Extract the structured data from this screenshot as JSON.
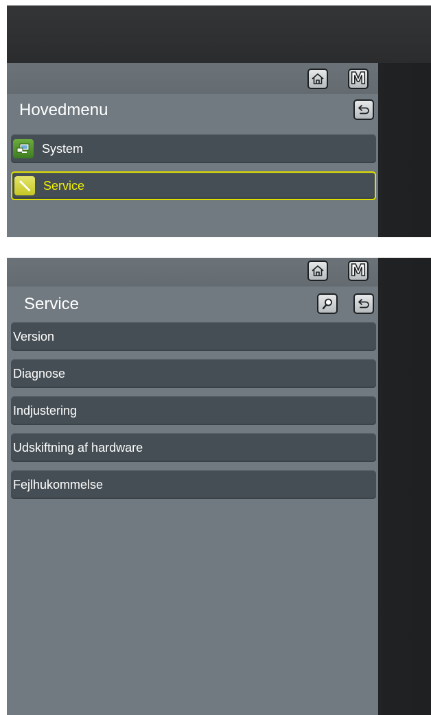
{
  "colors": {
    "screen_bg": "#707a80",
    "item_bg": "#454e54",
    "selected_border": "#dede00",
    "selected_text": "#f2f200",
    "bezel": "#232527"
  },
  "top_screen": {
    "title": "Hovedmenu",
    "header_icons": [
      "home-icon",
      "m-icon"
    ],
    "back_icon": "back-icon",
    "m_label": "M",
    "items": [
      {
        "label": "System",
        "icon": "system-icon",
        "selected": false
      },
      {
        "label": "Service",
        "icon": "wrench-icon",
        "selected": true
      }
    ]
  },
  "bottom_screen": {
    "title": "Service",
    "header_icons": [
      "home-icon",
      "m-icon"
    ],
    "search_icon": "search-icon",
    "back_icon": "back-icon",
    "m_label": "M",
    "items": [
      {
        "label": "Version"
      },
      {
        "label": "Diagnose"
      },
      {
        "label": "Indjustering"
      },
      {
        "label": "Udskiftning af hardware"
      },
      {
        "label": "Fejlhukommelse"
      }
    ]
  }
}
